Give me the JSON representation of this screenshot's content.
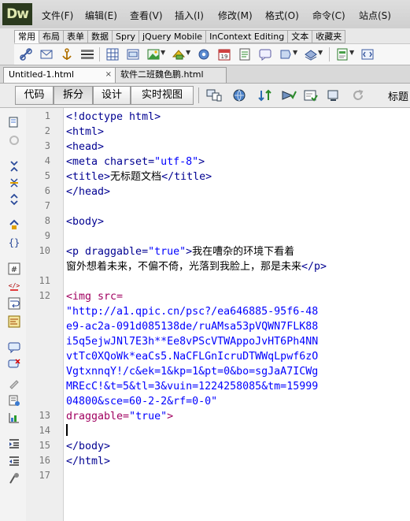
{
  "app": {
    "logo": "Dw",
    "menu": [
      "文件(F)",
      "编辑(E)",
      "查看(V)",
      "插入(I)",
      "修改(M)",
      "格式(O)",
      "命令(C)",
      "站点(S)"
    ]
  },
  "insert_panel": {
    "tabs": [
      "常用",
      "布局",
      "表单",
      "数据",
      "Spry",
      "jQuery Mobile",
      "InContext Editing",
      "文本",
      "收藏夹"
    ],
    "active_tab": "常用",
    "icons": [
      "hyperlink-icon",
      "email-link-icon",
      "named-anchor-icon",
      "horizontal-rule-icon",
      "table-icon",
      "insert-div-icon",
      "image-icon",
      "media-icon",
      "widget-icon",
      "date-icon",
      "server-include-icon",
      "comment-icon",
      "head-icon",
      "script-icon",
      "templates-icon",
      "tag-chooser-icon"
    ]
  },
  "documents": {
    "tabs": [
      {
        "label": "Untitled-1.html",
        "active": true
      },
      {
        "label": "软件二班魏色鹏.html",
        "active": false
      }
    ],
    "close_glyph": "×"
  },
  "view_toolbar": {
    "buttons": [
      "代码",
      "拆分",
      "设计",
      "实时视图"
    ],
    "pressed": "拆分",
    "title_label": "标题"
  },
  "left_toolbar": {
    "icons": [
      "open-documents-icon",
      "show-code-navigator-icon",
      "collapse-full-tag-icon",
      "collapse-selection-icon",
      "expand-all-icon",
      "select-parent-tag-icon",
      "balance-braces-icon",
      "line-numbers-icon",
      "highlight-invalid-code-icon",
      "word-wrap-icon",
      "syntax-coloring-icon",
      "apply-comment-icon",
      "remove-comment-icon",
      "wrap-tag-icon",
      "recent-snippets-icon",
      "move-css-icon",
      "indent-code-icon",
      "outdent-code-icon",
      "format-source-icon"
    ]
  },
  "editor": {
    "line_numbers": [
      "1",
      "2",
      "3",
      "4",
      "5",
      "6",
      "7",
      "8",
      "9",
      "10",
      "11",
      "12",
      "13",
      "14",
      "15",
      "16",
      "17"
    ],
    "lines": [
      {
        "ln": "1",
        "parts": [
          {
            "t": "<!doctype html>",
            "c": "tag"
          }
        ]
      },
      {
        "ln": "2",
        "parts": [
          {
            "t": "<html>",
            "c": "tag"
          }
        ]
      },
      {
        "ln": "3",
        "parts": [
          {
            "t": "<head>",
            "c": "tag"
          }
        ]
      },
      {
        "ln": "4",
        "parts": [
          {
            "t": "<meta charset=",
            "c": "tag"
          },
          {
            "t": "\"utf-8\"",
            "c": "val"
          },
          {
            "t": ">",
            "c": "tag"
          }
        ]
      },
      {
        "ln": "5",
        "parts": [
          {
            "t": "<title>",
            "c": "tag"
          },
          {
            "t": "无标题文档",
            "c": "txt"
          },
          {
            "t": "</title>",
            "c": "tag"
          }
        ]
      },
      {
        "ln": "6",
        "parts": [
          {
            "t": "</head>",
            "c": "tag"
          }
        ]
      },
      {
        "ln": "7",
        "parts": []
      },
      {
        "ln": "8",
        "parts": [
          {
            "t": "<body>",
            "c": "tag"
          }
        ]
      },
      {
        "ln": "9",
        "parts": []
      },
      {
        "ln": "10",
        "parts": [
          {
            "t": "<p draggable=",
            "c": "tag"
          },
          {
            "t": "\"true\"",
            "c": "val"
          },
          {
            "t": ">",
            "c": "tag"
          },
          {
            "t": "我在嘈杂的环境下看着",
            "c": "txt"
          }
        ]
      },
      {
        "ln": "",
        "parts": [
          {
            "t": "窗外想着未来，不偏不倚，光落到我脸上，那是未来",
            "c": "txt"
          },
          {
            "t": "</p>",
            "c": "tag"
          }
        ]
      },
      {
        "ln": "11",
        "parts": []
      },
      {
        "ln": "12",
        "parts": [
          {
            "t": "<img src=",
            "c": "tag-img"
          }
        ]
      },
      {
        "ln": "",
        "parts": [
          {
            "t": "\"http://a1.qpic.cn/psc?/ea646885-95f6-48",
            "c": "val"
          }
        ]
      },
      {
        "ln": "",
        "parts": [
          {
            "t": "e9-ac2a-091d085138de/ruAMsa53pVQWN7FLK88",
            "c": "val"
          }
        ]
      },
      {
        "ln": "",
        "parts": [
          {
            "t": "i5q5ejwJNl7E3h**Ee8vPScVTWAppoJvHT6Ph4NN",
            "c": "val"
          }
        ]
      },
      {
        "ln": "",
        "parts": [
          {
            "t": "vtTc0XQoWk*eaCs5.NaCFLGnIcruDTWWqLpwf6zO",
            "c": "val"
          }
        ]
      },
      {
        "ln": "",
        "parts": [
          {
            "t": "VgtxnnqY!/c&ek=1&kp=1&pt=0&bo=sgJaA7ICWg",
            "c": "val"
          }
        ]
      },
      {
        "ln": "",
        "parts": [
          {
            "t": "MREcC!&t=5&tl=3&vuin=1224258085&tm=15999",
            "c": "val"
          }
        ]
      },
      {
        "ln": "",
        "parts": [
          {
            "t": "04800&sce=60-2-2&rf=0-0\"",
            "c": "val"
          }
        ]
      },
      {
        "ln": "13",
        "parts": [
          {
            "t": "draggable=",
            "c": "tag-img"
          },
          {
            "t": "\"true\"",
            "c": "val"
          },
          {
            "t": ">",
            "c": "tag-img"
          }
        ]
      },
      {
        "ln": "14",
        "parts": []
      },
      {
        "ln": "15",
        "parts": [
          {
            "t": "</body>",
            "c": "tag"
          }
        ]
      },
      {
        "ln": "16",
        "parts": [
          {
            "t": "</html>",
            "c": "tag"
          }
        ]
      },
      {
        "ln": "17",
        "parts": []
      }
    ]
  }
}
